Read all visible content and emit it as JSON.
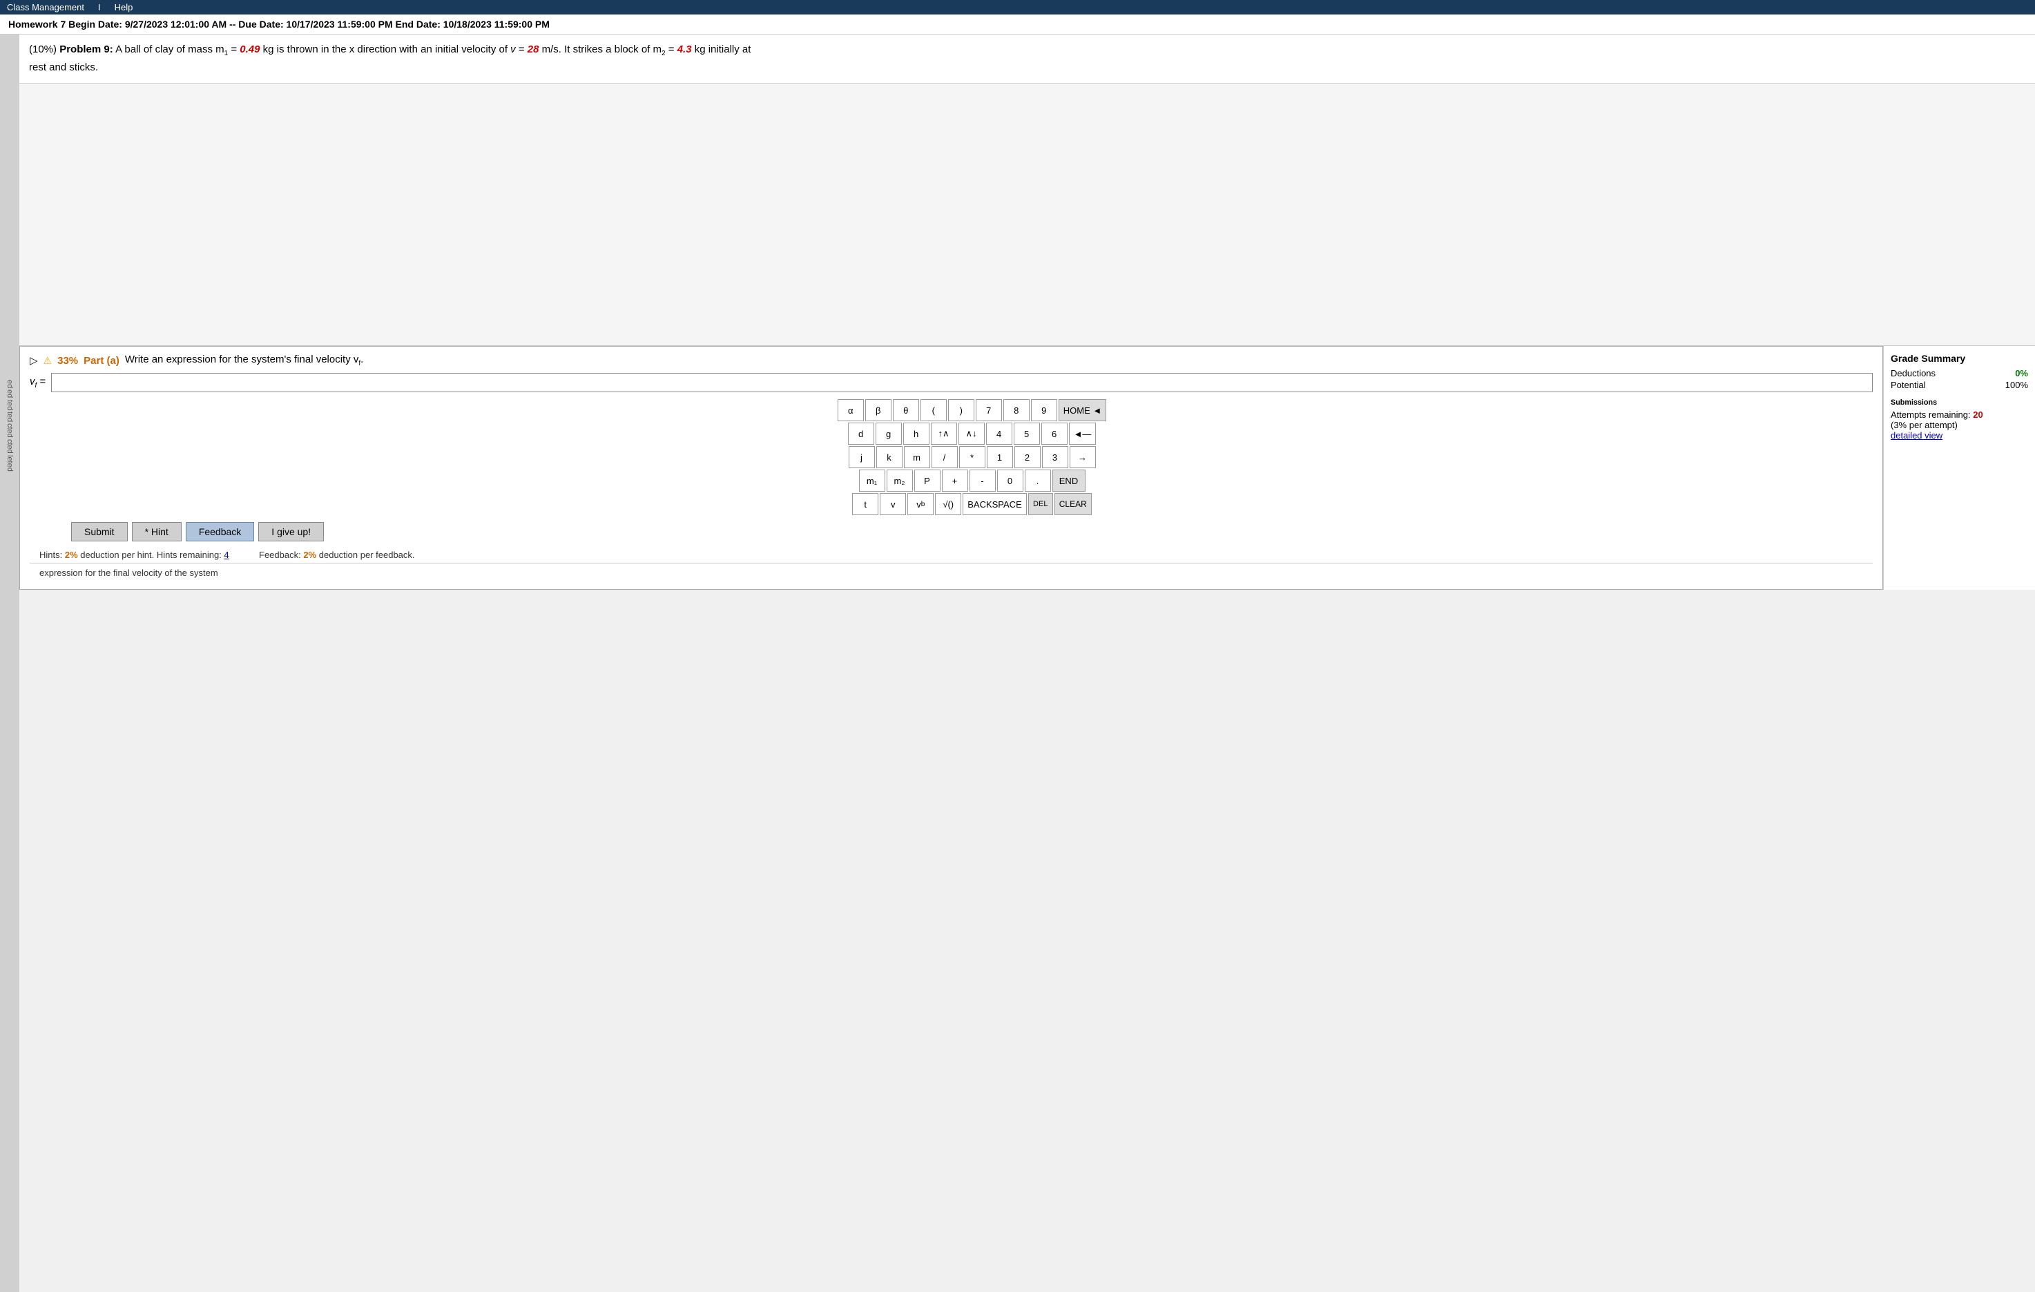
{
  "topbar": {
    "items": [
      "Class Management",
      "I",
      "Help"
    ]
  },
  "homework": {
    "title": "Homework 7",
    "begin_label": "Begin Date:",
    "begin_date": "9/27/2023 12:01:00 AM",
    "due_label": "-- Due Date:",
    "due_date": "10/17/2023 11:59:00 PM",
    "end_label": "End Date:",
    "end_date": "10/18/2023 11:59:00 PM"
  },
  "problem": {
    "number": "Problem 9:",
    "percent": "(10%)",
    "text_before_m1": "A ball of clay of mass m",
    "m1_sub": "1",
    "text_eq": " =",
    "m1_val": " 0.49",
    "text_after_m1": " kg is thrown in the x direction with an initial velocity of v =",
    "v_val": " 28",
    "text_after_v": " m/s. It strikes a block of m",
    "m2_sub": "2",
    "text_eq2": " =",
    "m2_val": " 4.3",
    "text_after_m2": " kg initially at rest and sticks."
  },
  "sidebar_labels": [
    "ed",
    "ed",
    "ted",
    "ted",
    "cted",
    "cted",
    "leted"
  ],
  "part_a": {
    "percent": "33%",
    "label": "Part (a)",
    "question": "Write an expression for the system's final velocity v",
    "vf_sub": "f",
    "question_end": ".",
    "vf_label": "v",
    "vf_label_sub": "f",
    "equals": "=",
    "input_value": ""
  },
  "keyboard": {
    "rows": [
      [
        "α",
        "β",
        "θ",
        "(",
        ")",
        "7",
        "8",
        "9",
        "HOME ◄"
      ],
      [
        "d",
        "g",
        "h",
        "↑∧",
        "∧↓",
        "4",
        "5",
        "6",
        "◄—"
      ],
      [
        "j",
        "k",
        "m",
        "/",
        "*",
        "1",
        "2",
        "3",
        "→"
      ],
      [
        "m₁",
        "m₂",
        "P",
        "+",
        "-",
        "0",
        ".",
        "END"
      ],
      [
        "t",
        "v",
        "v_b",
        "√()",
        "BACKSPACE",
        "DEL",
        "CLEAR"
      ]
    ],
    "keys_row1": [
      "α",
      "β",
      "θ",
      "(",
      ")",
      "7",
      "8",
      "9",
      "HOME ◄"
    ],
    "keys_row2": [
      "d",
      "g",
      "h",
      "↑∧",
      "∧↓",
      "4",
      "5",
      "6",
      "◄—"
    ],
    "keys_row3": [
      "j",
      "k",
      "m",
      "/",
      "*",
      "1",
      "2",
      "3",
      "→"
    ],
    "keys_row4": [
      "m₁",
      "m₂",
      "P",
      "+",
      "-",
      "0",
      ".",
      "END"
    ],
    "keys_row5": [
      "t",
      "v",
      "v_b",
      "√()",
      "BACKSPACE",
      "DEL",
      "CLEAR"
    ]
  },
  "actions": {
    "submit": "Submit",
    "hint": "* Hint",
    "feedback": "Feedback",
    "give_up": "I give up!"
  },
  "hints": {
    "text": "Hints:",
    "deduction": "2%",
    "label": "deduction per hint. Hints remaining:",
    "remaining": "4"
  },
  "feedback_row": {
    "label": "Feedback:",
    "deduction": "2%",
    "text": "deduction per feedback."
  },
  "grade_summary": {
    "title": "Grade Summary",
    "deductions_label": "Deductions",
    "deductions_val": "0%",
    "potential_label": "Potential",
    "potential_val": "100%"
  },
  "submissions": {
    "title": "Submissions",
    "attempts_label": "Attempts remaining:",
    "attempts_val": "20",
    "per_attempt": "(3% per attempt)",
    "detailed_link": "detailed view"
  },
  "bottom_note": "expression for the final velocity of the system"
}
